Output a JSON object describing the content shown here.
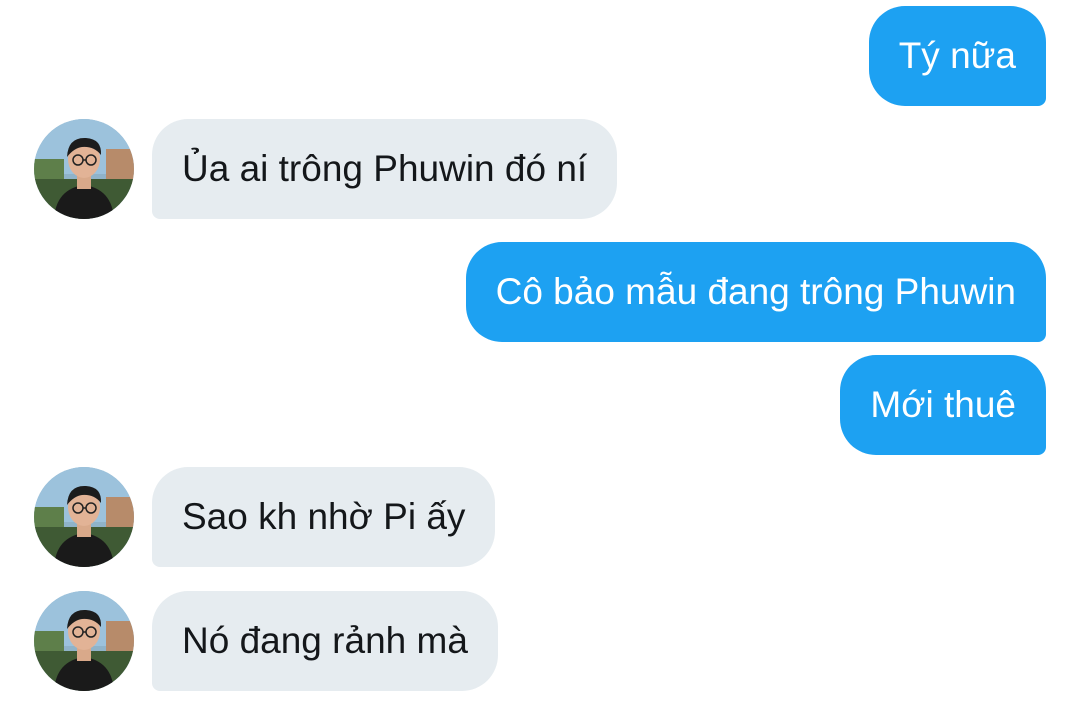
{
  "messages": [
    {
      "direction": "outgoing",
      "text": "Tý nữa"
    },
    {
      "direction": "incoming",
      "text": "Ủa ai trông Phuwin đó ní"
    },
    {
      "direction": "outgoing",
      "text": "Cô bảo mẫu đang trông Phuwin"
    },
    {
      "direction": "outgoing",
      "text": "Mới thuê"
    },
    {
      "direction": "incoming",
      "text": "Sao kh nhờ Pi ấy"
    },
    {
      "direction": "incoming",
      "text": "Nó đang rảnh mà"
    }
  ],
  "colors": {
    "outgoing_bubble": "#1da1f2",
    "incoming_bubble": "#e6ecf0",
    "outgoing_text": "#ffffff",
    "incoming_text": "#14171a"
  },
  "avatar": {
    "icon": "user-avatar-photo"
  }
}
